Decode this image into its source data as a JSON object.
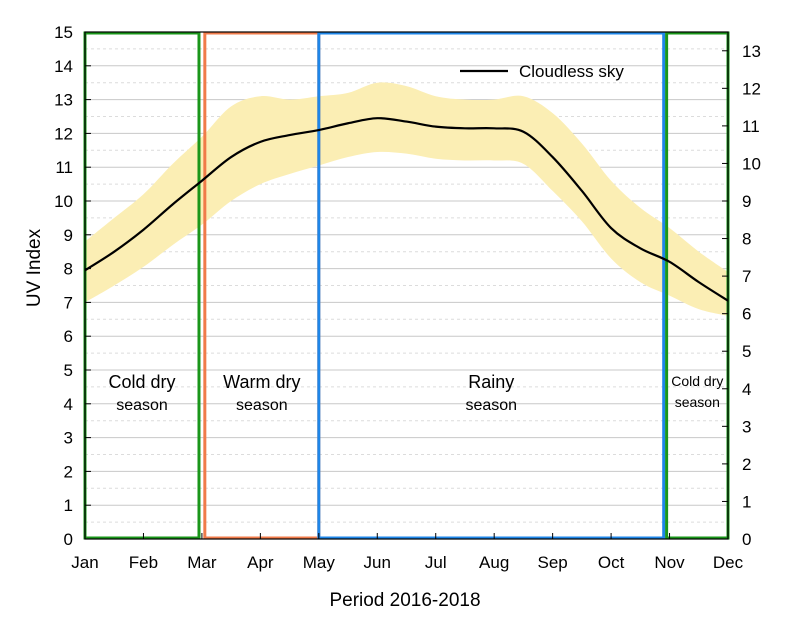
{
  "chart_data": {
    "type": "line",
    "xlabel": "Period 2016-2018",
    "ylabel": "UV Index",
    "categories": [
      "Jan",
      "Feb",
      "Mar",
      "Apr",
      "May",
      "Jun",
      "Jul",
      "Aug",
      "Sep",
      "Oct",
      "Nov",
      "Dec"
    ],
    "ylim": [
      0,
      15
    ],
    "y_ticks": [
      0,
      1,
      2,
      3,
      4,
      5,
      6,
      7,
      8,
      9,
      10,
      11,
      12,
      13,
      14,
      15
    ],
    "y2_ticks": [
      0,
      1,
      2,
      3,
      4,
      5,
      6,
      7,
      8,
      9,
      10,
      11,
      12,
      13
    ],
    "grid": true,
    "legend_position": "top-right",
    "series": [
      {
        "name": "Cloudless sky",
        "color": "#000000",
        "x": [
          0,
          0.5,
          1,
          1.5,
          2,
          2.5,
          3,
          3.5,
          4,
          4.5,
          5,
          5.5,
          6,
          6.5,
          7,
          7.5,
          8,
          8.5,
          9,
          9.5,
          10,
          10.5,
          11
        ],
        "values": [
          7.95,
          8.5,
          9.15,
          9.9,
          10.6,
          11.3,
          11.75,
          11.95,
          12.1,
          12.3,
          12.45,
          12.35,
          12.2,
          12.15,
          12.15,
          12.05,
          11.3,
          10.3,
          9.2,
          8.6,
          8.2,
          7.6,
          7.05
        ]
      }
    ],
    "band": {
      "color": "#fbeeb4",
      "x": [
        0,
        0.5,
        1,
        1.5,
        2,
        2.5,
        3,
        3.5,
        4,
        4.5,
        5,
        5.5,
        6,
        6.5,
        7,
        7.5,
        8,
        8.5,
        9,
        9.5,
        10,
        10.5,
        11
      ],
      "upper": [
        8.8,
        9.5,
        10.2,
        11.1,
        11.9,
        12.8,
        13.1,
        13.0,
        13.1,
        13.2,
        13.5,
        13.4,
        13.1,
        13.0,
        13.0,
        13.1,
        12.6,
        11.7,
        10.6,
        9.8,
        9.2,
        8.5,
        7.9
      ],
      "lower": [
        7.0,
        7.5,
        8.05,
        8.7,
        9.3,
        10.0,
        10.5,
        10.8,
        11.05,
        11.3,
        11.45,
        11.4,
        11.25,
        11.2,
        11.2,
        11.1,
        10.3,
        9.4,
        8.3,
        7.6,
        7.2,
        6.8,
        6.6
      ]
    },
    "seasons": [
      {
        "x0": 0,
        "x1": 1.95,
        "color": "#1a961a",
        "line1": "Cold dry",
        "line2": "season",
        "size": "normal"
      },
      {
        "x0": 2.05,
        "x1": 4.0,
        "color": "#f07b4a",
        "line1": "Warm dry",
        "line2": "season",
        "size": "normal"
      },
      {
        "x0": 4.0,
        "x1": 9.9,
        "color": "#1e86e8",
        "line1": "Rainy",
        "line2": "season",
        "size": "normal"
      },
      {
        "x0": 9.95,
        "x1": 11.0,
        "color": "#1a961a",
        "line1": "Cold dry",
        "line2": "season",
        "size": "small"
      }
    ]
  }
}
